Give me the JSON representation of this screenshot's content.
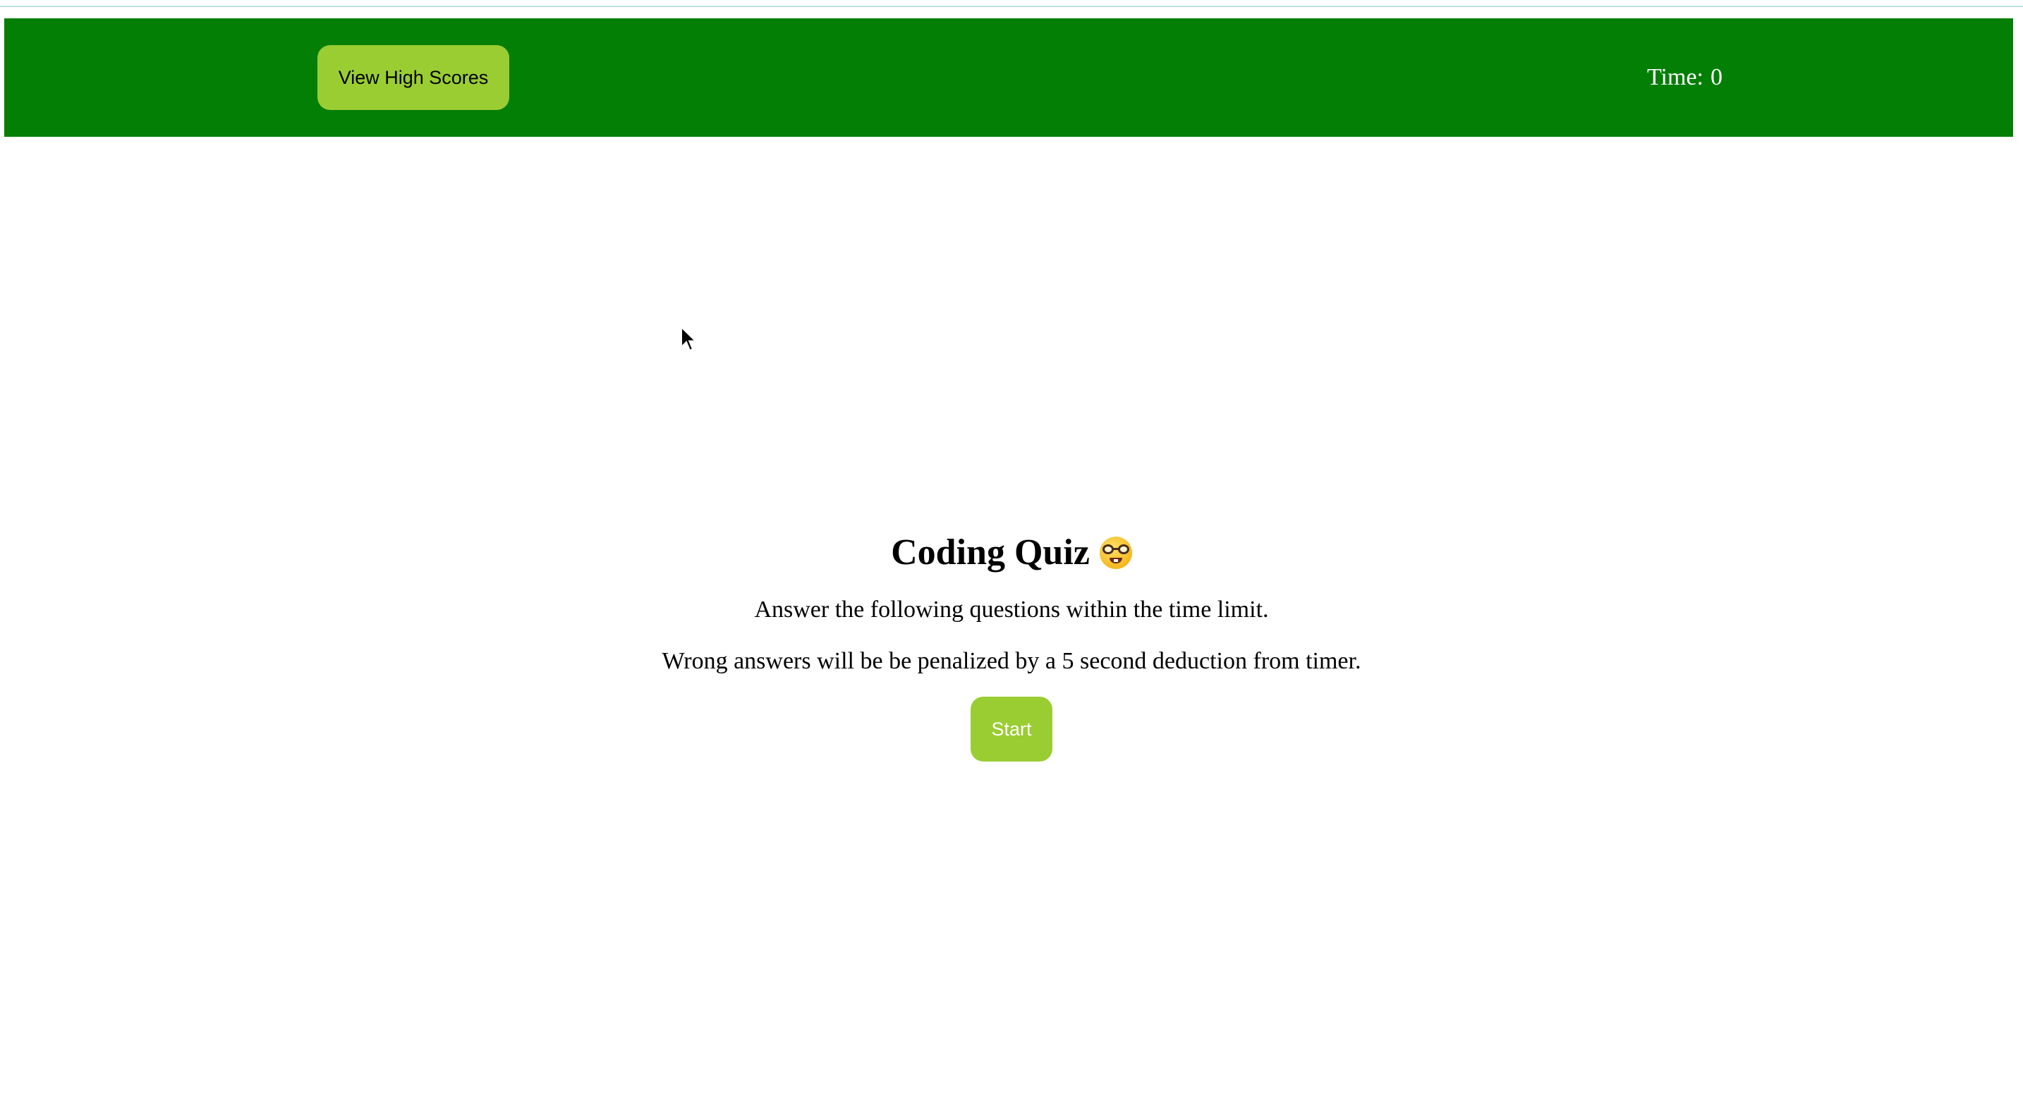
{
  "header": {
    "high_scores_label": "View High Scores",
    "timer_label": "Time:",
    "timer_value": "0"
  },
  "intro": {
    "title": "Coding Quiz",
    "title_icon": "nerd-face-icon",
    "line1": "Answer the following questions within the time limit.",
    "line2": "Wrong answers will be be penalized by a 5 second deduction from timer.",
    "start_label": "Start"
  },
  "colors": {
    "header_bg": "#037f06",
    "button_bg": "#9acd32",
    "timer_text": "#ffffff",
    "start_text": "#ffffff",
    "high_scores_text": "#000000"
  }
}
